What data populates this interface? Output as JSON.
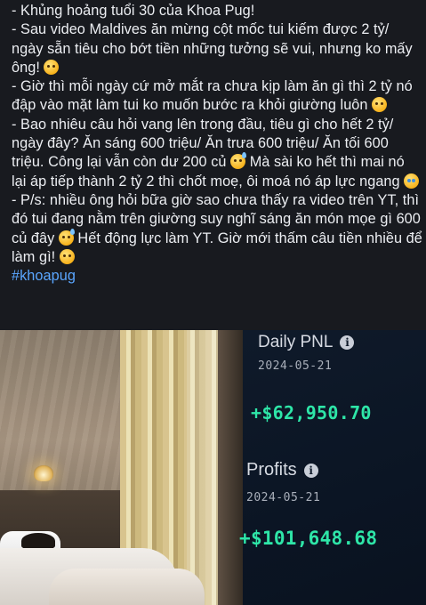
{
  "post": {
    "line1": "- Khủng hoảng tuổi 30 của Khoa Pug!",
    "line2a": "- Sau video Maldives ăn mừng cột mốc tui kiếm được 2 tỷ/ ngày sẵn tiêu cho bớt tiền những tưởng sẽ vui, nhưng ko mấy ông!",
    "line3a": "- Giờ thì mỗi ngày cứ mở mắt ra chưa kịp làm ăn gì thì 2 tỷ nó đập vào mặt làm tui ko muốn bước ra khỏi giường luôn",
    "line4a": "- Bao nhiêu câu hỏi vang lên trong đầu, tiêu gì cho hết 2 tỷ/ ngày đây? Ăn sáng 600 triệu/ Ăn trưa 600 triệu/ Ăn tối 600 triệu. Công lại vẫn còn dư 200 củ",
    "line4b": " Mà sài ko hết thì mai nó lại áp tiếp thành 2 tỷ 2 thì chốt moẹ, ôi moá nó áp lực ngang",
    "line5a": "- P/s: nhiều ông hỏi bữa giờ sao chưa thấy ra video trên YT, thì đó tui đang nằm trên giường suy nghĩ sáng ăn món mọe gì 600 củ đây",
    "line5b": " Hết động lực làm YT. Giờ mới thấm câu tiền nhiều để làm gì!",
    "hashtag": "#khoapug"
  },
  "phone": {
    "daily_label": "Daily PNL",
    "daily_date": "2024-05-21",
    "daily_amount": "+$62,950.70",
    "profits_label": "Profits",
    "profits_date": "2024-05-21",
    "profits_amount": "+$101,648.68",
    "info_glyph": "i",
    "accent_color": "#2ee6a8"
  }
}
